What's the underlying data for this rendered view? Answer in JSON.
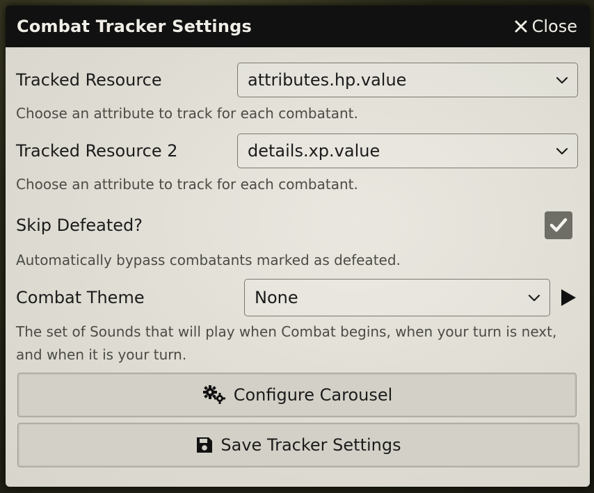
{
  "window": {
    "title": "Combat Tracker Settings",
    "close_label": "Close"
  },
  "fields": {
    "tracked_resource": {
      "label": "Tracked Resource",
      "value": "attributes.hp.value",
      "hint": "Choose an attribute to track for each combatant."
    },
    "tracked_resource_2": {
      "label": "Tracked Resource 2",
      "value": "details.xp.value",
      "hint": "Choose an attribute to track for each combatant."
    },
    "skip_defeated": {
      "label": "Skip Defeated?",
      "checked": true,
      "hint": "Automatically bypass combatants marked as defeated."
    },
    "combat_theme": {
      "label": "Combat Theme",
      "value": "None",
      "hint": "The set of Sounds that will play when Combat begins, when your turn is next, and when it is your turn."
    }
  },
  "buttons": {
    "configure_carousel": "Configure Carousel",
    "save_settings": "Save Tracker Settings"
  },
  "icons": {
    "close": "close-icon",
    "chevron": "chevron-down-icon",
    "check": "check-icon",
    "play": "play-icon",
    "cogs": "cogs-icon",
    "save": "floppy-disk-icon"
  },
  "colors": {
    "header_bg": "#111111",
    "content_bg": "#e2e0d7",
    "checkbox_bg": "#6e6d66",
    "text": "#1b1b1b",
    "hint_text": "#4b4a45"
  }
}
